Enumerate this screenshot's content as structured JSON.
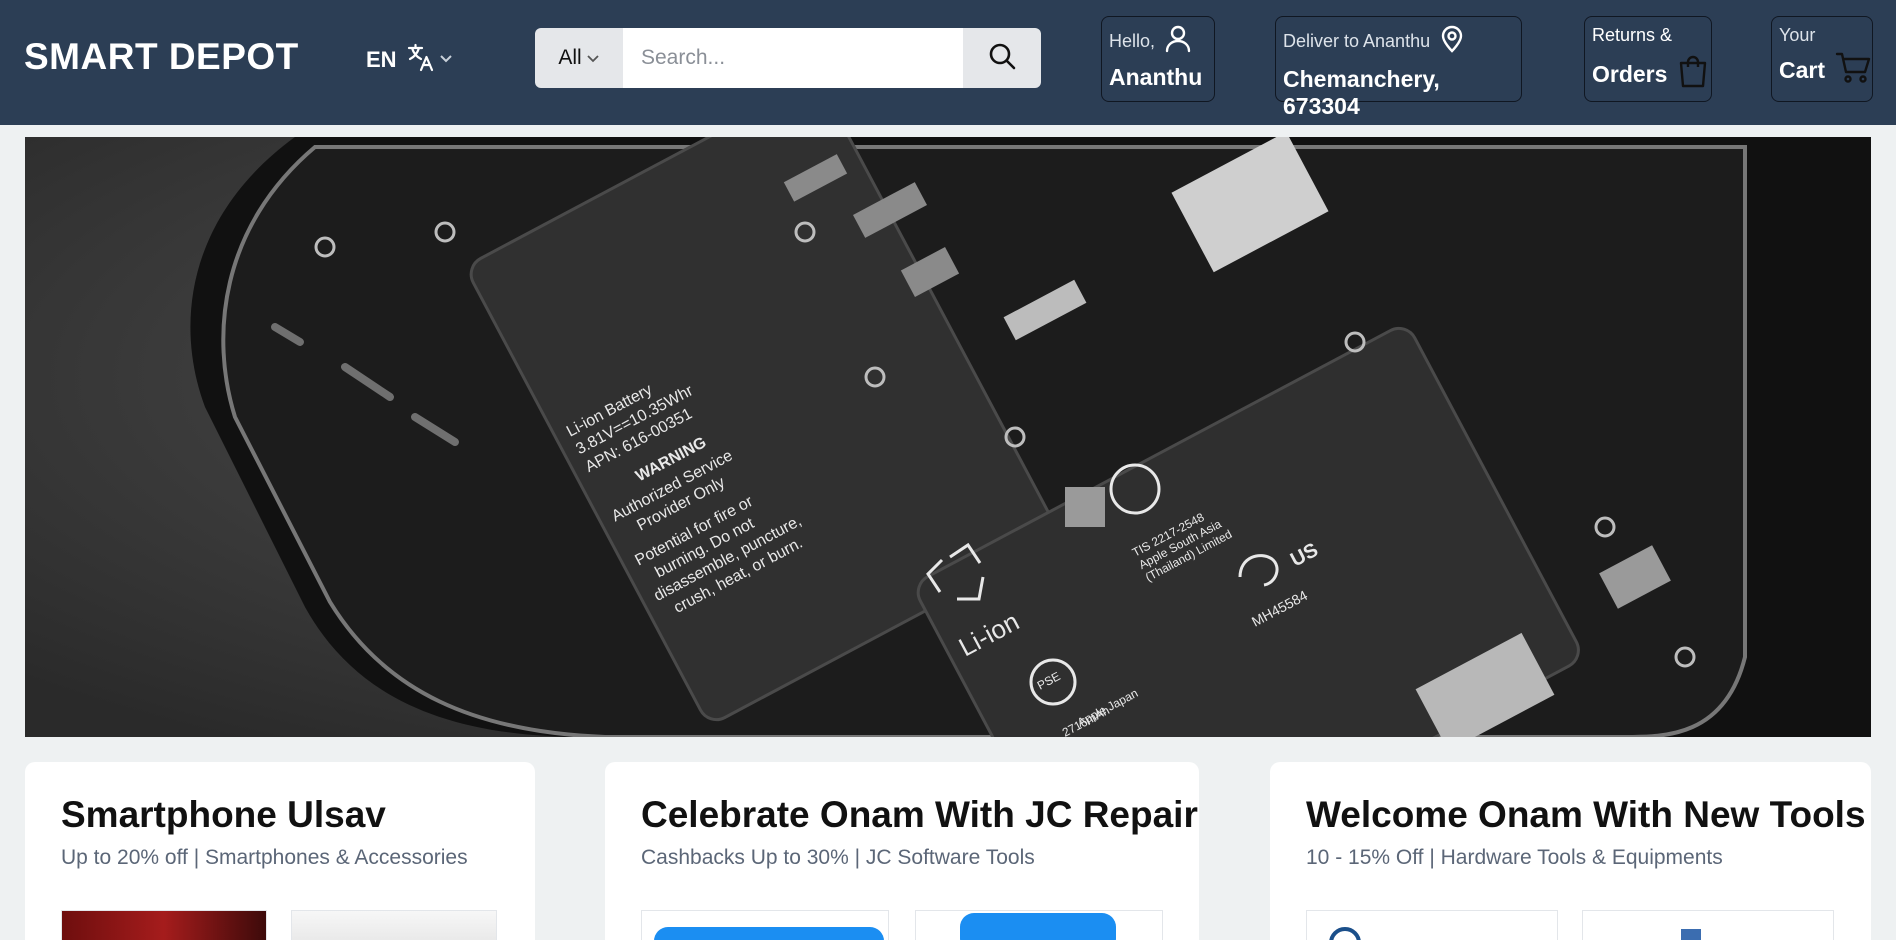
{
  "header": {
    "logo": "SMART DEPOT",
    "language": {
      "code": "EN",
      "icon": "translate-icon"
    },
    "search": {
      "category": "All",
      "placeholder": "Search..."
    },
    "account": {
      "greeting": "Hello,",
      "name": "Ananthu"
    },
    "deliver": {
      "label": "Deliver to Ananthu",
      "address": "Chemanchery, 673304"
    },
    "orders": {
      "line1": "Returns &",
      "line2": "Orders"
    },
    "cart": {
      "line1": "Your",
      "line2": "Cart"
    }
  },
  "hero": {
    "battery_left": [
      "Li-ion Battery",
      "3.81V==10.35Whr",
      "APN: 616-00351",
      "WARNING",
      "Authorized Service",
      "Provider Only",
      "Potential for fire or",
      "burning. Do not",
      "disassemble, puncture,",
      "crush, heat, or burn."
    ],
    "battery_right": [
      "TIS 2217-2548",
      "Apple South Asia",
      "(Thailand) Limited",
      "Li-ion",
      "2716mAh",
      "Apple Japan",
      "US",
      "MH45584",
      "PSE"
    ]
  },
  "promos": [
    {
      "title": "Smartphone Ulsav",
      "subtitle": "Up to 20% off | Smartphones & Accessories"
    },
    {
      "title": "Celebrate Onam With JC Repair",
      "subtitle": "Cashbacks Up to 30% | JC Software Tools"
    },
    {
      "title": "Welcome Onam With New Tools",
      "subtitle": "10 - 15% Off | Hardware Tools & Equipments"
    }
  ],
  "colors": {
    "header_bg": "#2c3e55",
    "page_bg": "#eef1f2"
  }
}
